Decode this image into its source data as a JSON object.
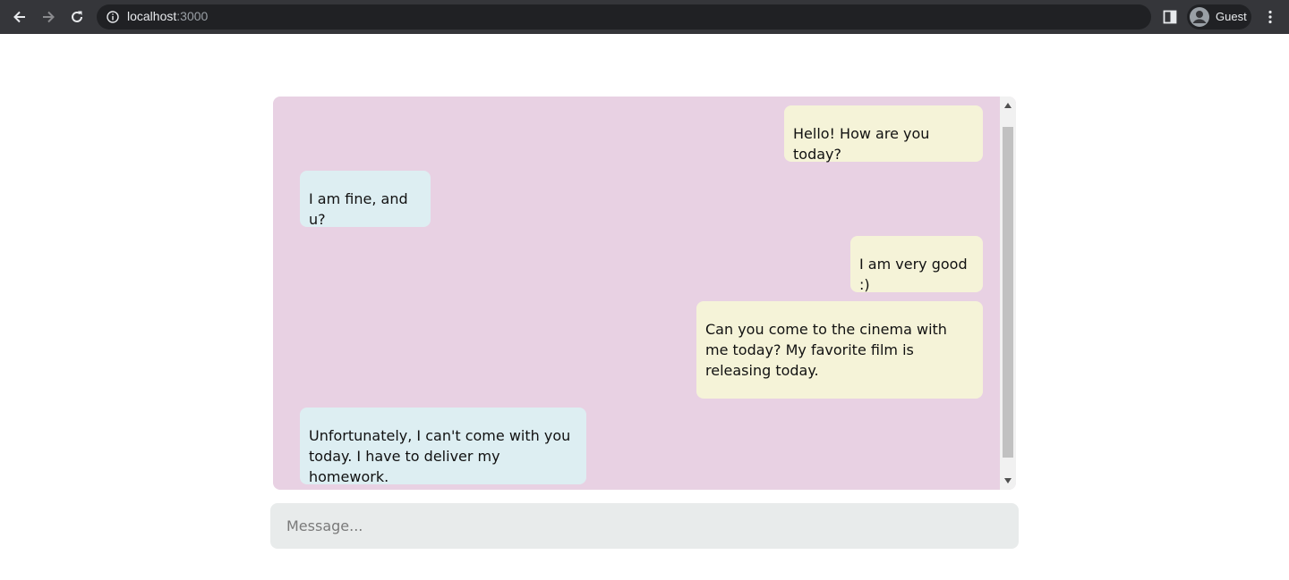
{
  "browser": {
    "url_host": "localhost",
    "url_port": ":3000",
    "profile_label": "Guest",
    "icons": [
      "back-arrow-icon",
      "forward-arrow-icon",
      "reload-icon",
      "info-icon",
      "side-panel-icon",
      "avatar-icon",
      "kebab-menu-icon"
    ]
  },
  "chat": {
    "background": "#e8d1e3",
    "sent_color": "#f5f3d8",
    "received_color": "#ddeef2",
    "messages": [
      {
        "sender": "me",
        "text": "Hello! How are you today?"
      },
      {
        "sender": "other",
        "text": "I am fine, and u?"
      },
      {
        "sender": "me",
        "text": "I am very good :)"
      },
      {
        "sender": "me",
        "text": "Can you come to the cinema with me today? My favorite film is releasing today."
      },
      {
        "sender": "other",
        "text": "Unfortunately, I can't come with you today. I have to deliver my homework."
      }
    ]
  },
  "composer": {
    "placeholder": "Message...",
    "value": ""
  }
}
